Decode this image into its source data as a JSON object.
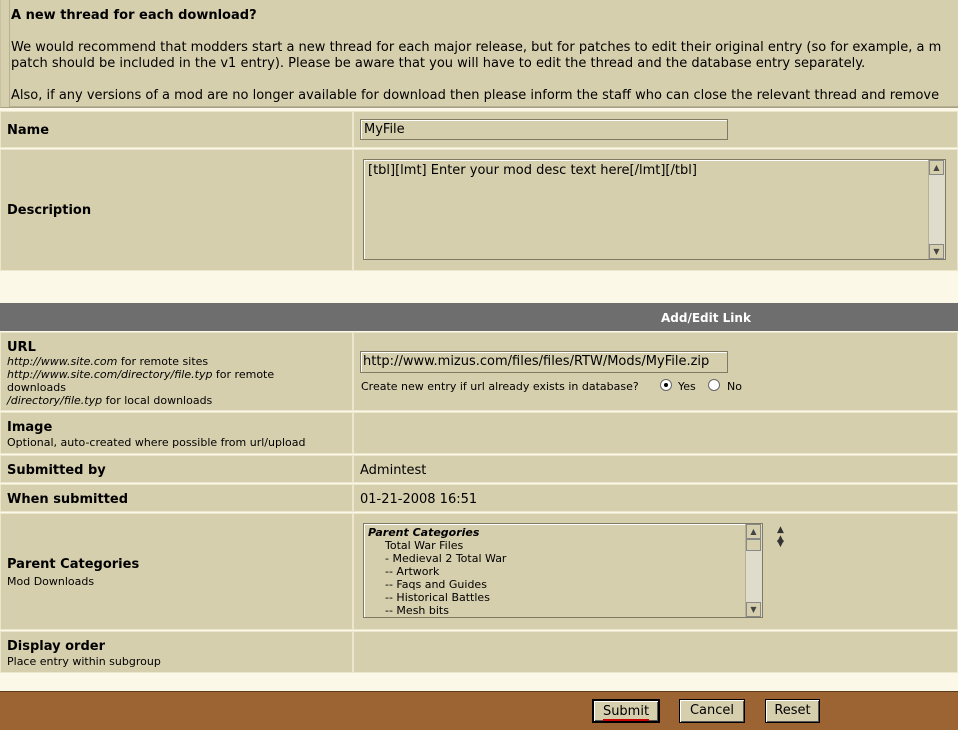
{
  "notice": {
    "heading": "A new thread for each download?",
    "line1": "We would recommend that modders start a new thread for each major release, but for patches to edit their original entry (so for example, a m",
    "line2": "patch should be included in the v1 entry). Please be aware that you will have to edit the thread and the database entry separately.",
    "line3": "Also, if any versions of a mod are no longer available for download then please inform the staff who can close the relevant thread and remove"
  },
  "name": {
    "label": "Name",
    "value": "MyFile"
  },
  "description": {
    "label": "Description",
    "value": "[tbl][lmt] Enter your mod desc text here[/lmt][/tbl]"
  },
  "link_section": {
    "title": "Add/Edit Link"
  },
  "url": {
    "label": "URL",
    "help1_italic": "http://www.site.com",
    "help1_rest": " for remote sites",
    "help2_italic": "http://www.site.com/directory/file.typ",
    "help2_rest": " for remote",
    "help2_cont": "downloads",
    "help3_italic": "/directory/file.typ",
    "help3_rest": " for local downloads",
    "value": "http://www.mizus.com/files/files/RTW/Mods/MyFile.zip",
    "create_question": "Create new entry if url already exists in database?",
    "yes": "Yes",
    "no": "No",
    "selected": "Yes"
  },
  "image": {
    "label": "Image",
    "sub": "Optional, auto-created where possible from url/upload"
  },
  "submitted_by": {
    "label": "Submitted by",
    "value": "Admintest"
  },
  "when_submitted": {
    "label": "When submitted",
    "value": "01-21-2008 16:51"
  },
  "parent_categories": {
    "label": "Parent Categories",
    "sub": "Mod Downloads",
    "list_header": "Parent Categories",
    "options": [
      "Total War Files",
      "- Medieval 2 Total War",
      "-- Artwork",
      "-- Faqs and Guides",
      "-- Historical Battles",
      "-- Mesh bits"
    ]
  },
  "display_order": {
    "label": "Display order",
    "sub": "Place entry within subgroup"
  },
  "buttons": {
    "submit": "Submit",
    "cancel": "Cancel",
    "reset": "Reset"
  },
  "colors": {
    "panel": "#d6cfae",
    "header_bar": "#6e6e6e",
    "footer_bar": "#9b6432",
    "page": "#fbf8e8"
  }
}
